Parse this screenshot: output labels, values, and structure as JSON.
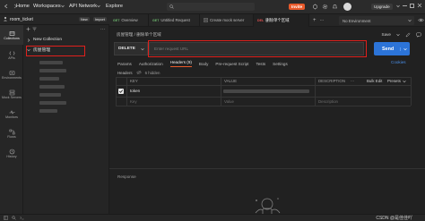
{
  "topbar": {
    "home": "Home",
    "workspaces": "Workspaces",
    "api_network": "API Network",
    "explore": "Explore",
    "invite_label": "Invite",
    "upgrade_label": "Upgrade"
  },
  "sidebar": {
    "workspace_name": "room_ticket",
    "new_button": "New",
    "import_button": "Import",
    "items": [
      {
        "label": "Collections"
      },
      {
        "label": "APIs"
      },
      {
        "label": "Environments"
      },
      {
        "label": "Mock Servers"
      },
      {
        "label": "Monitors"
      },
      {
        "label": "Flows"
      },
      {
        "label": "History"
      }
    ],
    "new_collection": "New Collection",
    "collection_name": "房屋管理"
  },
  "tabs": [
    {
      "method": "GET",
      "label": "Overview"
    },
    {
      "method": "GET",
      "label": "Untitled Request"
    },
    {
      "method": "",
      "label": "Create mock server"
    },
    {
      "method": "DEL",
      "label": "删除单个区域"
    }
  ],
  "env": {
    "label": "No Environment"
  },
  "request": {
    "breadcrumb": "房屋管理 / 删除单个区域",
    "save_label": "Save",
    "method": "DELETE",
    "url_placeholder": "Enter request URL",
    "send_label": "Send",
    "cookies_label": "Cookies"
  },
  "subtabs": [
    "Params",
    "Authorization",
    "Headers (9)",
    "Body",
    "Pre-request Script",
    "Tests",
    "Settings"
  ],
  "headers_section": {
    "label": "Headers",
    "hidden": "6 hidden",
    "col_key": "KEY",
    "col_value": "VALUE",
    "col_description": "DESCRIPTION",
    "bulk_edit": "Bulk Edit",
    "presets": "Presets",
    "rows": [
      {
        "key": "token"
      }
    ],
    "placeholder_key": "Key",
    "placeholder_value": "Value",
    "placeholder_desc": "Description"
  },
  "response": {
    "label": "Response"
  },
  "watermark": "CSDN @是佳佳吖"
}
